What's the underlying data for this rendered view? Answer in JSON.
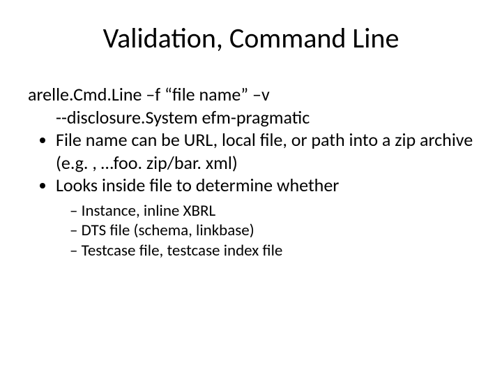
{
  "title": "Validation, Command Line",
  "command": {
    "line1": "arelle.Cmd.Line –f “file name” –v",
    "line2": "--disclosure.System efm-pragmatic"
  },
  "bullets": [
    "File name can be URL, local file, or path into a zip archive (e.g. , …foo. zip/bar. xml)",
    "Looks inside file to determine whether"
  ],
  "subbullets": [
    "Instance, inline XBRL",
    "DTS file (schema, linkbase)",
    "Testcase file, testcase index file"
  ]
}
